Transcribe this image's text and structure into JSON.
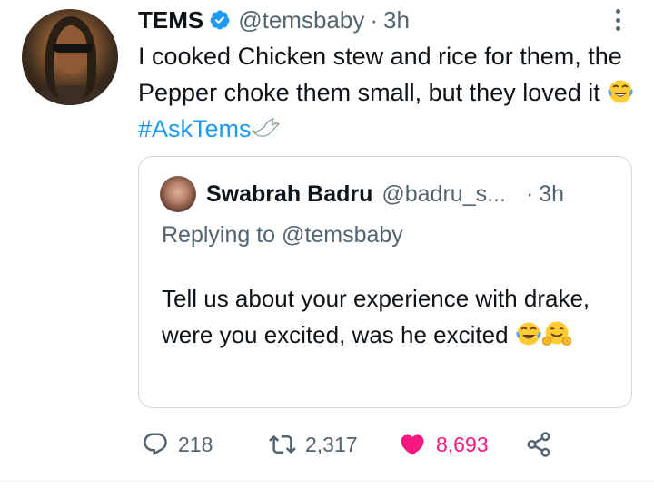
{
  "tweet": {
    "author_name": "TEMS",
    "handle": "@temsbaby",
    "separator": "·",
    "time": "3h",
    "text_main": "I cooked Chicken stew and rice for them, the Pepper choke them small, but they loved it",
    "hashtag": "#AskTems",
    "emojis": [
      "face-with-tears-of-joy",
      "dove"
    ]
  },
  "quote": {
    "author_name": "Swabrah Badru",
    "handle": "@badru_s...",
    "separator": "·",
    "time": "3h",
    "replying_to": "Replying to @temsbaby",
    "text": "Tell us about your experience with drake,  were you excited,  was he excited",
    "emojis": [
      "face-with-tears-of-joy",
      "hugging-face"
    ]
  },
  "actions": {
    "replies": "218",
    "retweets": "2,317",
    "likes": "8,693"
  },
  "colors": {
    "link": "#1d9bf0",
    "secondary_text": "#536471",
    "like": "#f91880",
    "verified": "#1d9bf0",
    "border": "#cfd9de"
  },
  "icons": [
    "more-icon",
    "verified-badge-icon",
    "reply-icon",
    "retweet-icon",
    "heart-icon",
    "share-icon"
  ]
}
